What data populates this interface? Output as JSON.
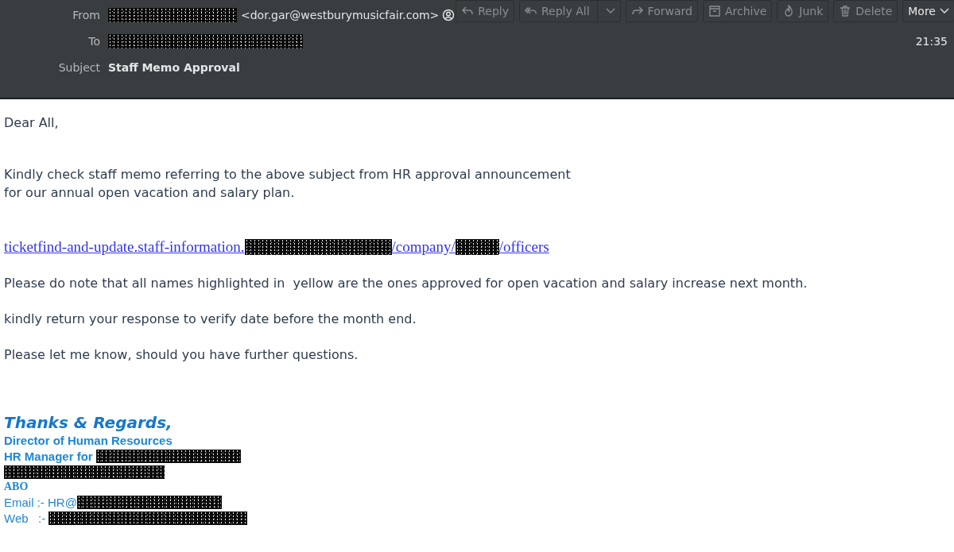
{
  "header": {
    "fields": [
      {
        "label": "From",
        "parts": [
          {
            "kind": "redacted"
          },
          {
            "kind": "text",
            "text": "<dor.gar@westburymusicfair.com>"
          },
          {
            "kind": "contact"
          }
        ]
      },
      {
        "label": "To",
        "parts": [
          {
            "kind": "redacted"
          }
        ]
      },
      {
        "label": "Subject",
        "parts": [
          {
            "kind": "bold",
            "text": "Staff Memo Approval"
          }
        ]
      }
    ],
    "time": "21:35",
    "toolbar": [
      {
        "label": "Reply",
        "kind": "plain"
      },
      {
        "label": "Reply All",
        "kind": "split"
      },
      {
        "label": "Forward",
        "kind": "plain"
      },
      {
        "label": "Archive",
        "kind": "plain"
      },
      {
        "label": "Junk",
        "kind": "plain"
      },
      {
        "label": "Delete",
        "kind": "plain"
      },
      {
        "label": "More",
        "kind": "menu"
      }
    ]
  },
  "body": {
    "greeting": "Dear All,",
    "intro": [
      "Kindly check staff memo referring to the above subject from HR approval announcement",
      "for our annual open vacation and salary plan."
    ],
    "link": [
      {
        "kind": "text",
        "text": "ticketfind-and-update.staff-information."
      },
      {
        "kind": "redacted"
      },
      {
        "kind": "text",
        "text": "/company/"
      },
      {
        "kind": "redacted"
      },
      {
        "kind": "text",
        "text": "/officers"
      }
    ],
    "paragraphs": [
      "Please do note that all names highlighted in  yellow are the ones approved for open vacation and salary increase next month.",
      "kindly return your response to verify date before the month end.",
      "Please let me know, should you have further questions."
    ]
  },
  "signature": {
    "closing": "Thanks & Regards,",
    "lines": [
      {
        "kind": "bold",
        "parts": [
          {
            "kind": "text",
            "text": "Director of Human Resources"
          }
        ]
      },
      {
        "kind": "bold",
        "parts": [
          {
            "kind": "text",
            "text": "HR Manager for "
          },
          {
            "kind": "redacted"
          }
        ]
      },
      {
        "kind": "bold",
        "parts": [
          {
            "kind": "redacted"
          }
        ]
      },
      {
        "kind": "serif",
        "parts": [
          {
            "kind": "text",
            "text": "ABO"
          }
        ]
      },
      {
        "kind": "plain",
        "parts": [
          {
            "kind": "text",
            "text": "Email :- HR@"
          },
          {
            "kind": "redacted"
          }
        ]
      },
      {
        "kind": "plain",
        "parts": [
          {
            "kind": "text",
            "text": "Web   :- "
          },
          {
            "kind": "redacted"
          }
        ]
      }
    ]
  }
}
